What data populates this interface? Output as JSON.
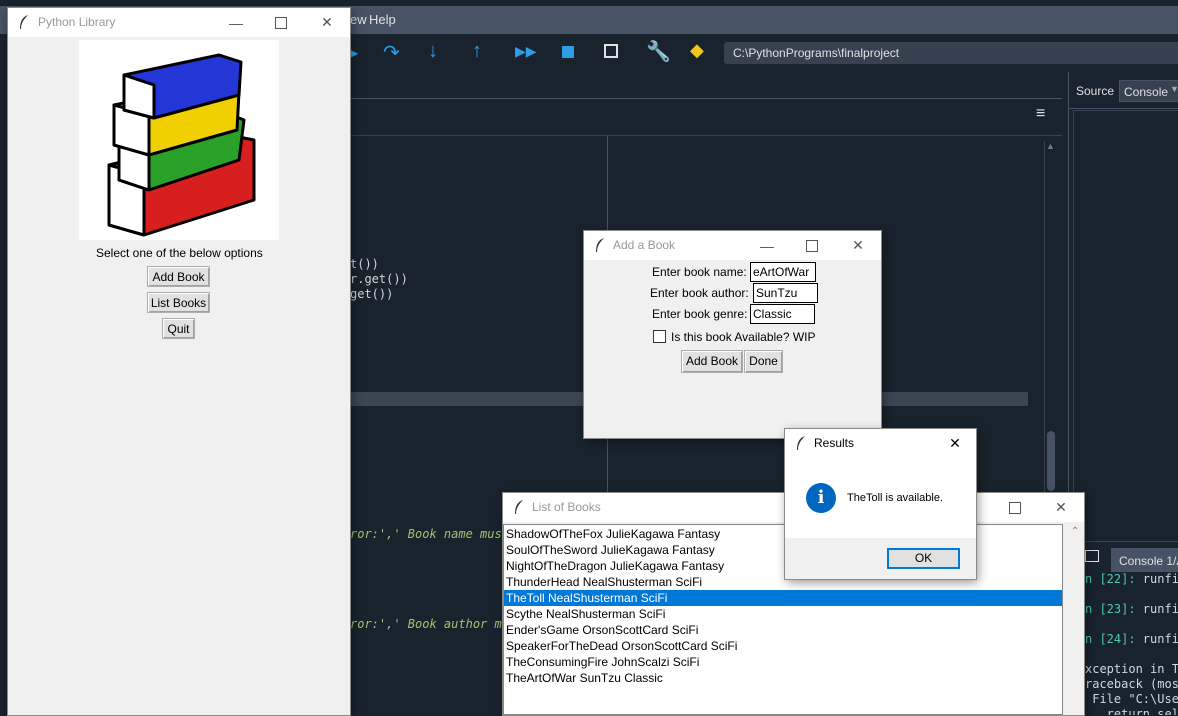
{
  "ide": {
    "menu": {
      "view_tail": "ew",
      "help": "Help"
    },
    "path": "C:\\PythonPrograms\\finalproject",
    "panel_tabs": {
      "source": "Source",
      "console": "Console"
    },
    "console_tab": "Console 1/A",
    "code_fragments": [
      "t())",
      "r.get())",
      "get())"
    ],
    "error_lines": [
      "ror:',' Book name must",
      "ror:',' Book author mu"
    ],
    "console_lines": [
      {
        "prefix": "n [22]:",
        "text": " runfi"
      },
      {
        "prefix": "n [23]:",
        "text": " runfi"
      },
      {
        "prefix": "n [24]:",
        "text": " runfi"
      },
      {
        "prefix": "",
        "text": "xception in T"
      },
      {
        "prefix": "",
        "text": "raceback (mos"
      },
      {
        "prefix": "",
        "text": " File \"C:\\Use"
      },
      {
        "prefix": "",
        "text": "   return sel"
      }
    ]
  },
  "library": {
    "title": "Python Library",
    "prompt": "Select one of the below options",
    "add_button": "Add Book",
    "list_button": "List Books",
    "quit_button": "Quit"
  },
  "add_book": {
    "title": "Add a Book",
    "name_label": "Enter book name:",
    "name_value": "eArtOfWar",
    "author_label": "Enter book author:",
    "author_value": "SunTzu",
    "genre_label": "Enter book genre:",
    "genre_value": "Classic",
    "available_label": "Is this book Available? WIP",
    "available_checked": false,
    "add_button": "Add Book",
    "done_button": "Done"
  },
  "results": {
    "title": "Results",
    "message": "TheToll is available.",
    "ok_button": "OK"
  },
  "list_books": {
    "title": "List of Books",
    "items": [
      "ShadowOfTheFox JulieKagawa Fantasy",
      "SoulOfTheSword JulieKagawa Fantasy",
      "NightOfTheDragon JulieKagawa Fantasy",
      "ThunderHead NealShusterman SciFi",
      "TheToll NealShusterman SciFi",
      "Scythe NealShusterman SciFi",
      "Ender'sGame OrsonScottCard SciFi",
      "SpeakerForTheDead OrsonScottCard SciFi",
      "TheConsumingFire JohnScalzi SciFi",
      "TheArtOfWar SunTzu Classic"
    ],
    "selected_index": 4
  },
  "colors": {
    "ide_bg": "#19232d",
    "selection": "#0078d7",
    "info_blue": "#0067c0"
  }
}
